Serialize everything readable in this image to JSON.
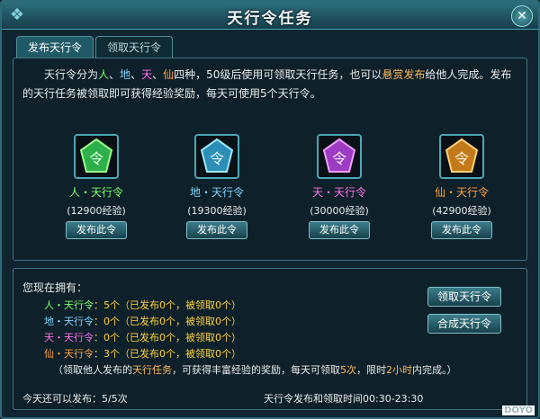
{
  "window": {
    "title": "天行令任务"
  },
  "tabs": [
    {
      "label": "发布天行令"
    },
    {
      "label": "领取天行令"
    }
  ],
  "intro": {
    "p1": "天行令分为",
    "ren": "人",
    "sep1": "、",
    "di": "地",
    "sep2": "、",
    "tian": "天",
    "sep3": "、",
    "xian": "仙",
    "p2": "四种，50级后使用可领取天行任务，也可以",
    "highlight": "悬赏发布",
    "p3": "给他人完成。发布的天行任务被领取即可获得经验奖励，每天可使用5个天行令。"
  },
  "cards": [
    {
      "name": "人・天行令",
      "exp": "(12900经验)",
      "button": "发布此令",
      "color": "#7dff6a"
    },
    {
      "name": "地・天行令",
      "exp": "(19300经验)",
      "button": "发布此令",
      "color": "#7fd6ff"
    },
    {
      "name": "天・天行令",
      "exp": "(30000经验)",
      "button": "发布此令",
      "color": "#ff6ee8"
    },
    {
      "name": "仙・天行令",
      "exp": "(42900经验)",
      "button": "发布此令",
      "color": "#ffa043"
    }
  ],
  "owned": {
    "title": "您现在拥有：",
    "lines": [
      {
        "name": "人・天行令",
        "rest": "：5个（已发布0个，被领取0个）",
        "color": "#7dff6a"
      },
      {
        "name": "地・天行令",
        "rest": "：0个（已发布0个，被领取0个）",
        "color": "#7fd6ff"
      },
      {
        "name": "天・天行令",
        "rest": "：0个（已发布0个，被领取0个）",
        "color": "#ff6ee8"
      },
      {
        "name": "仙・天行令",
        "rest": "：3个（已发布0个，被领取0个）",
        "color": "#ffa043"
      }
    ],
    "buttons": {
      "receive": "领取天行令",
      "combine": "合成天行令"
    }
  },
  "tip": {
    "a": "（领取他人发布的",
    "b": "天行任务",
    "c": "，可获得丰富经验的奖励，每天可领取",
    "d": "5次",
    "e": "，限时",
    "f": "2小时",
    "g": "内完成。）"
  },
  "footer": {
    "daily": "今天还可以发布：5/5次",
    "time": "天行令发布和领取时间00:30-23:30"
  },
  "watermark": "DOYO"
}
